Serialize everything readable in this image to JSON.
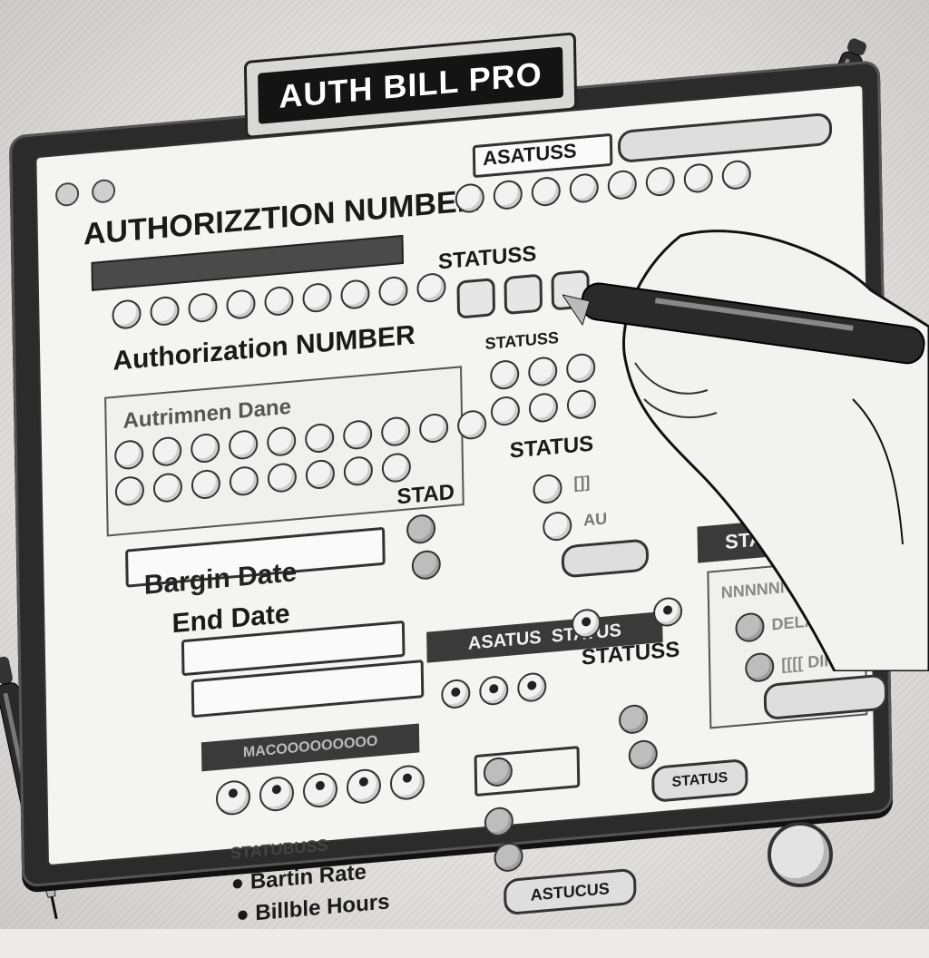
{
  "app": {
    "title": "AUTH BILL PRO"
  },
  "header": {
    "field_title": "AUTHORIZZTION NUMBER",
    "status_chip": "ASATUSS"
  },
  "left": {
    "auth_number_label": "Authorization NUMBER",
    "auth_date_label": "Autrimnen Dane",
    "begin_date_label": "Bargin Date",
    "end_date_label": "End Date",
    "blurred_header": "MACOOOOOOOOO",
    "status_label": "STATUBUSS",
    "bullets": [
      "Bartin Rate",
      "Billble Hours"
    ]
  },
  "middle": {
    "status_labels": [
      "STATUSS",
      "STATUSS",
      "STATUS",
      "STAD"
    ],
    "right_status_tags": [
      "[]]",
      "AU"
    ],
    "bottom_header": "ASATUS",
    "bottom_header_2": "STATUS",
    "status_label_bottom": "STATUSS",
    "status_button": "ASTUCUS",
    "status_button_2": "STATUS"
  },
  "right": {
    "status_header": "STATUSS",
    "lines": [
      "NNNNNNNNNNN",
      "DELAYS",
      "[[[[ DIIIIIIII"
    ]
  },
  "colors": {
    "ink": "#1a1a1a",
    "paper": "#f4f4f2",
    "frame": "#2b2b2b"
  },
  "icons": {
    "pen_left": "pen-icon",
    "pen_right": "pen-icon",
    "hand": "hand-with-pen-icon"
  }
}
